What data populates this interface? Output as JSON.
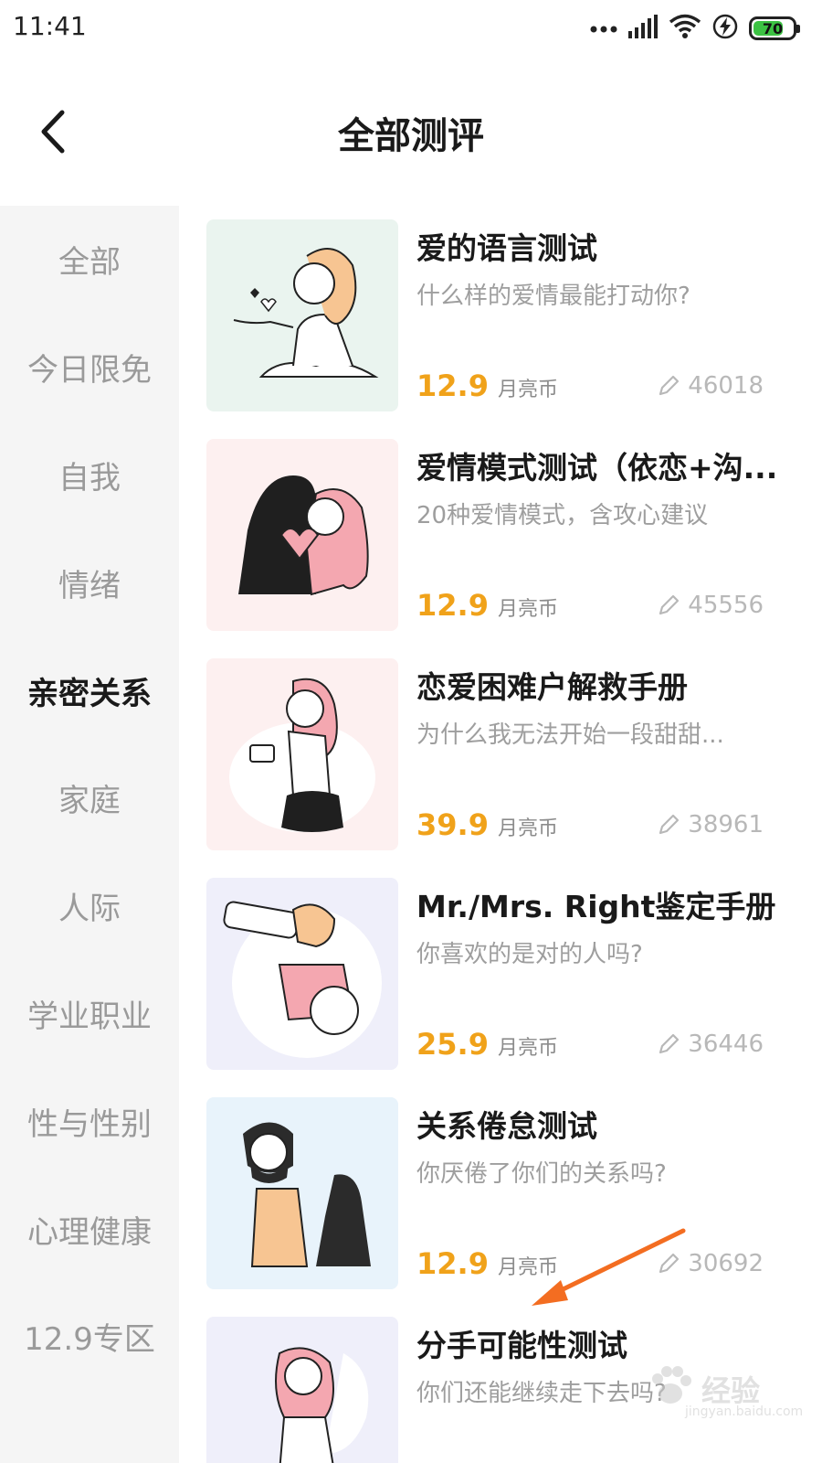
{
  "status_bar": {
    "time": "11:41",
    "battery": "70",
    "icons": [
      "more-dots-icon",
      "signal-icon",
      "wifi-icon",
      "charging-icon",
      "battery-icon"
    ]
  },
  "header": {
    "title": "全部测评"
  },
  "sidebar": {
    "items": [
      {
        "label": "全部",
        "active": false
      },
      {
        "label": "今日限免",
        "active": false
      },
      {
        "label": "自我",
        "active": false
      },
      {
        "label": "情绪",
        "active": false
      },
      {
        "label": "亲密关系",
        "active": true
      },
      {
        "label": "家庭",
        "active": false
      },
      {
        "label": "人际",
        "active": false
      },
      {
        "label": "学业职业",
        "active": false
      },
      {
        "label": "性与性别",
        "active": false
      },
      {
        "label": "心理健康",
        "active": false
      },
      {
        "label": "12.9专区",
        "active": false
      }
    ]
  },
  "cards": [
    {
      "title": "爱的语言测试",
      "desc": "什么样的爱情最能打动你?",
      "price": "12.9",
      "unit": "月亮币",
      "count": "46018",
      "bg": "#eaf4ef"
    },
    {
      "title": "爱情模式测试（依恋+沟...",
      "desc": "20种爱情模式，含攻心建议",
      "price": "12.9",
      "unit": "月亮币",
      "count": "45556",
      "bg": "#fdf0f0"
    },
    {
      "title": "恋爱困难户解救手册",
      "desc": "为什么我无法开始一段甜甜...",
      "price": "39.9",
      "unit": "月亮币",
      "count": "38961",
      "bg": "#fdf0f0"
    },
    {
      "title": "Mr./Mrs. Right鉴定手册",
      "desc": "你喜欢的是对的人吗?",
      "price": "25.9",
      "unit": "月亮币",
      "count": "36446",
      "bg": "#efeffa"
    },
    {
      "title": "关系倦怠测试",
      "desc": "你厌倦了你们的关系吗?",
      "price": "12.9",
      "unit": "月亮币",
      "count": "30692",
      "bg": "#e8f3fb"
    },
    {
      "title": "分手可能性测试",
      "desc": "你们还能继续走下去吗?",
      "price": "",
      "unit": "",
      "count": "",
      "bg": "#efeffa"
    }
  ],
  "watermark": {
    "text": "经验",
    "sub": "jingyan.baidu.com"
  },
  "colors": {
    "accent_price": "#f0a21a",
    "annotation_arrow": "#f36d21",
    "sidebar_bg": "#f5f5f5"
  }
}
